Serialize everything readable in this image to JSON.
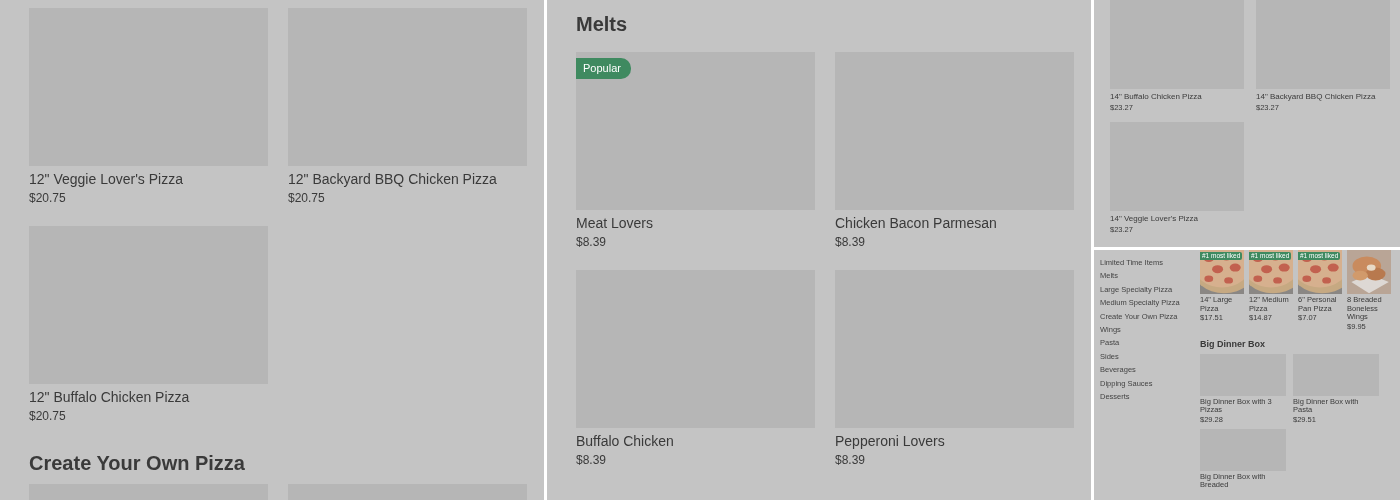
{
  "panels": [
    {
      "kind": "wide",
      "sections": [
        {
          "items": [
            {
              "kind": "plain",
              "name": "12\" Veggie Lover's Pizza",
              "price": "$20.75"
            },
            {
              "kind": "plain",
              "name": "12\" Backyard BBQ Chicken Pizza",
              "price": "$20.75"
            },
            {
              "kind": "plain",
              "name": "12\" Buffalo Chicken Pizza",
              "price": "$20.75"
            }
          ]
        },
        {
          "heading": "Create Your Own Pizza",
          "items": [
            {
              "kind": "cut"
            },
            {
              "kind": "cut"
            }
          ]
        }
      ]
    },
    {
      "kind": "wide",
      "sections": [
        {
          "heading": "Melts",
          "items": [
            {
              "kind": "plain",
              "name": "Meat Lovers",
              "price": "$8.39",
              "badge": "Popular"
            },
            {
              "kind": "plain",
              "name": "Chicken Bacon Parmesan",
              "price": "$8.39"
            },
            {
              "kind": "plain",
              "name": "Buffalo Chicken",
              "price": "$8.39"
            },
            {
              "kind": "plain",
              "name": "Pepperoni Lovers",
              "price": "$8.39"
            }
          ]
        }
      ]
    },
    {
      "kind": "compact",
      "sections": [
        {
          "items": [
            {
              "kind": "plain",
              "name": "14\" Buffalo Chicken Pizza",
              "price": "$23.27"
            },
            {
              "kind": "plain",
              "name": "14\" Backyard BBQ Chicken Pizza",
              "price": "$23.27"
            },
            {
              "kind": "plain",
              "name": "14\" Veggie Lover's Pizza",
              "price": "$23.27"
            }
          ]
        }
      ]
    },
    {
      "kind": "mini",
      "sidebar": [
        "Limited Time Items",
        "Melts",
        "Large Specialty Pizza",
        "Medium Specialty Pizza",
        "Create Your Own Pizza",
        "Wings",
        "Pasta",
        "Sides",
        "Beverages",
        "Dipping Sauces",
        "Desserts"
      ],
      "sections": [
        {
          "items": [
            {
              "name": "14\" Large Pizza",
              "price": "$17.51",
              "badge": "#1 most liked"
            },
            {
              "name": "12\" Medium Pizza",
              "price": "$14.87",
              "badge": "#1 most liked"
            },
            {
              "name": "6\" Personal Pan Pizza",
              "price": "$7.07",
              "badge": "#1 most liked"
            },
            {
              "kind": "wings",
              "name": "8 Breaded Boneless Wings",
              "price": "$9.95"
            }
          ]
        },
        {
          "heading": "Big Dinner Box",
          "items": [
            {
              "kind": "plain",
              "name": "Big Dinner Box with 3 Pizzas",
              "price": "$29.28"
            },
            {
              "kind": "plain",
              "name": "Big Dinner Box with Pasta",
              "price": "$29.51"
            },
            {
              "kind": "plain",
              "name": "Big Dinner Box with Breaded"
            }
          ]
        }
      ]
    }
  ]
}
